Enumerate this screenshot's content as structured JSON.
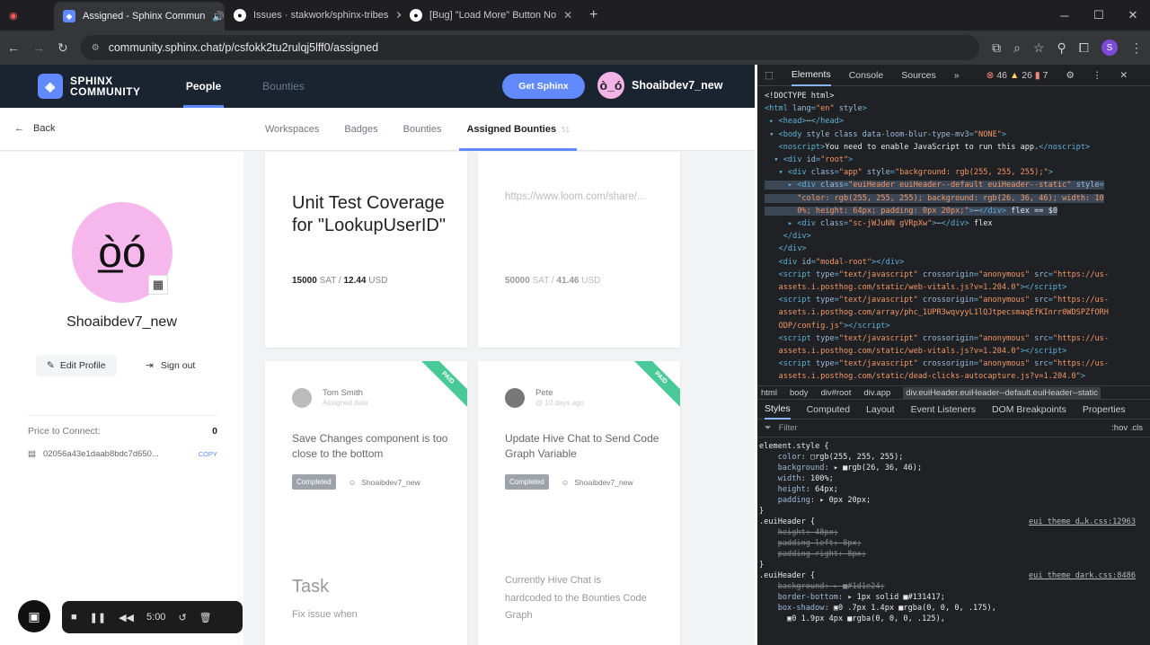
{
  "browser": {
    "tabs": [
      {
        "title": "Assigned - Sphinx Commun",
        "active": true
      },
      {
        "title": "Issues · stakwork/sphinx-tribes",
        "active": false
      },
      {
        "title": "[Bug] \"Load More\" Button No",
        "active": false
      }
    ],
    "url": "community.sphinx.chat/p/csfokk2tu2rulqj5lff0/assigned",
    "profile_initial": "S"
  },
  "app": {
    "logo_line1": "SPHINX",
    "logo_line2": "COMMUNITY",
    "nav": [
      "People",
      "Bounties"
    ],
    "get_sphinx": "Get Sphinx",
    "username": "Shoaibdev7_new",
    "back": "Back",
    "subtabs": [
      "Workspaces",
      "Badges",
      "Bounties",
      "Assigned Bounties"
    ],
    "subtab_count": "51",
    "profile": {
      "name": "Shoaibdev7_new",
      "edit": "Edit Profile",
      "signout": "Sign out",
      "price_label": "Price to Connect:",
      "price_value": "0",
      "pubkey": "02056a43e1daab8bdc7d650...",
      "copy": "COPY"
    },
    "cards": [
      {
        "title": "Unit Test Coverage for \"LookupUserID\"",
        "sat": "15000",
        "sat_unit": "SAT /",
        "usd": "12.44",
        "usd_unit": "USD"
      },
      {
        "link": "https://www.loom.com/share/...",
        "sat": "50000",
        "sat_unit": "SAT /",
        "usd": "41.46",
        "usd_unit": "USD"
      },
      {
        "person": "Tom Smith",
        "person_sub": "Assigned date",
        "paid": "PAID",
        "desc": "Save Changes component is too close to the bottom",
        "status": "Completed",
        "assignee": "Shoaibdev7_new",
        "body_title": "Task",
        "body_text": "Fix issue when"
      },
      {
        "person": "Pete",
        "person_sub": "@ 10 days ago",
        "paid": "PAID",
        "desc": "Update Hive Chat to Send Code Graph Variable",
        "status": "Completed",
        "assignee": "Shoaibdev7_new",
        "body_text": "Currently Hive Chat is hardcoded to the Bounties Code Graph"
      }
    ],
    "recorder": {
      "time": "5:00"
    }
  },
  "devtools": {
    "tabs": [
      "Elements",
      "Console",
      "Sources"
    ],
    "errors": "46",
    "warnings": "26",
    "issues": "7",
    "breadcrumbs": [
      "html",
      "body",
      "div#root",
      "div.app",
      "div.euiHeader.euiHeader--default.euiHeader--static"
    ],
    "style_tabs": [
      "Styles",
      "Computed",
      "Layout",
      "Event Listeners",
      "DOM Breakpoints",
      "Properties"
    ],
    "filter": "Filter",
    "filter_right": ":hov .cls"
  }
}
